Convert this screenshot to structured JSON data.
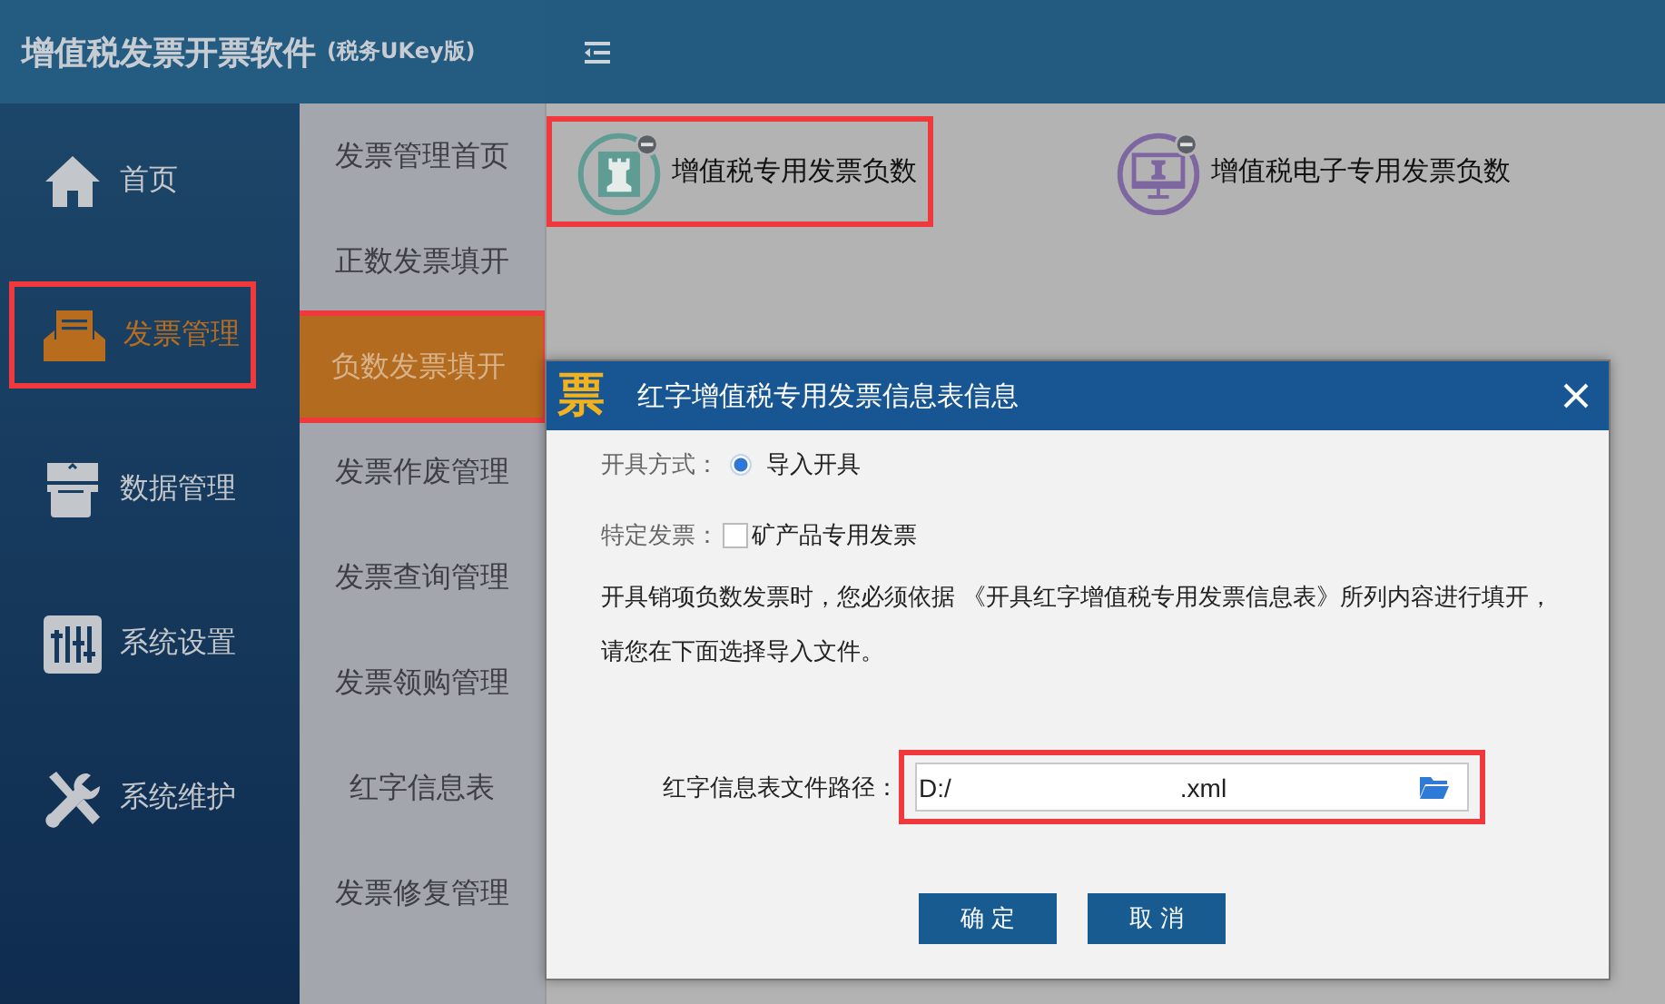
{
  "app": {
    "title": "增值税发票开票软件",
    "edition": "(税务UKey版)"
  },
  "sidebar": {
    "items": [
      {
        "label": "首页",
        "kind": "home",
        "selected": false,
        "highlighted": false
      },
      {
        "label": "发票管理",
        "kind": "tray",
        "selected": true,
        "highlighted": true
      },
      {
        "label": "数据管理",
        "kind": "data",
        "selected": false,
        "highlighted": false
      },
      {
        "label": "系统设置",
        "kind": "sliders",
        "selected": false,
        "highlighted": false
      },
      {
        "label": "系统维护",
        "kind": "tools",
        "selected": false,
        "highlighted": false
      }
    ]
  },
  "submenu": {
    "items": [
      {
        "label": "发票管理首页",
        "selected": false,
        "highlighted": false
      },
      {
        "label": "正数发票填开",
        "selected": false,
        "highlighted": false
      },
      {
        "label": "负数发票填开",
        "selected": true,
        "highlighted": true
      },
      {
        "label": "发票作废管理",
        "selected": false,
        "highlighted": false
      },
      {
        "label": "发票查询管理",
        "selected": false,
        "highlighted": false
      },
      {
        "label": "发票领购管理",
        "selected": false,
        "highlighted": false
      },
      {
        "label": "红字信息表",
        "selected": false,
        "highlighted": false
      },
      {
        "label": "发票修复管理",
        "selected": false,
        "highlighted": false
      }
    ]
  },
  "cards": [
    {
      "label": "增值税专用发票负数",
      "kind": "special",
      "highlighted": true
    },
    {
      "label": "增值税电子专用发票负数",
      "kind": "electronic",
      "highlighted": false
    }
  ],
  "dialog": {
    "logo_glyph": "票",
    "title": "红字增值税专用发票信息表信息",
    "issue_mode": {
      "label": "开具方式：",
      "option": "导入开具",
      "selected": true
    },
    "special_invoice": {
      "label": "特定发票：",
      "option": "矿产品专用发票",
      "checked": false
    },
    "note": "开具销项负数发票时，您必须依据 《开具红字增值税专用发票信息表》所列内容进行填开，请您在下面选择导入文件。",
    "path": {
      "label": "红字信息表文件路径：",
      "value_parts": [
        "D:/",
        ".xml"
      ],
      "highlighted": true
    },
    "buttons": [
      "确 定",
      "取 消"
    ]
  }
}
